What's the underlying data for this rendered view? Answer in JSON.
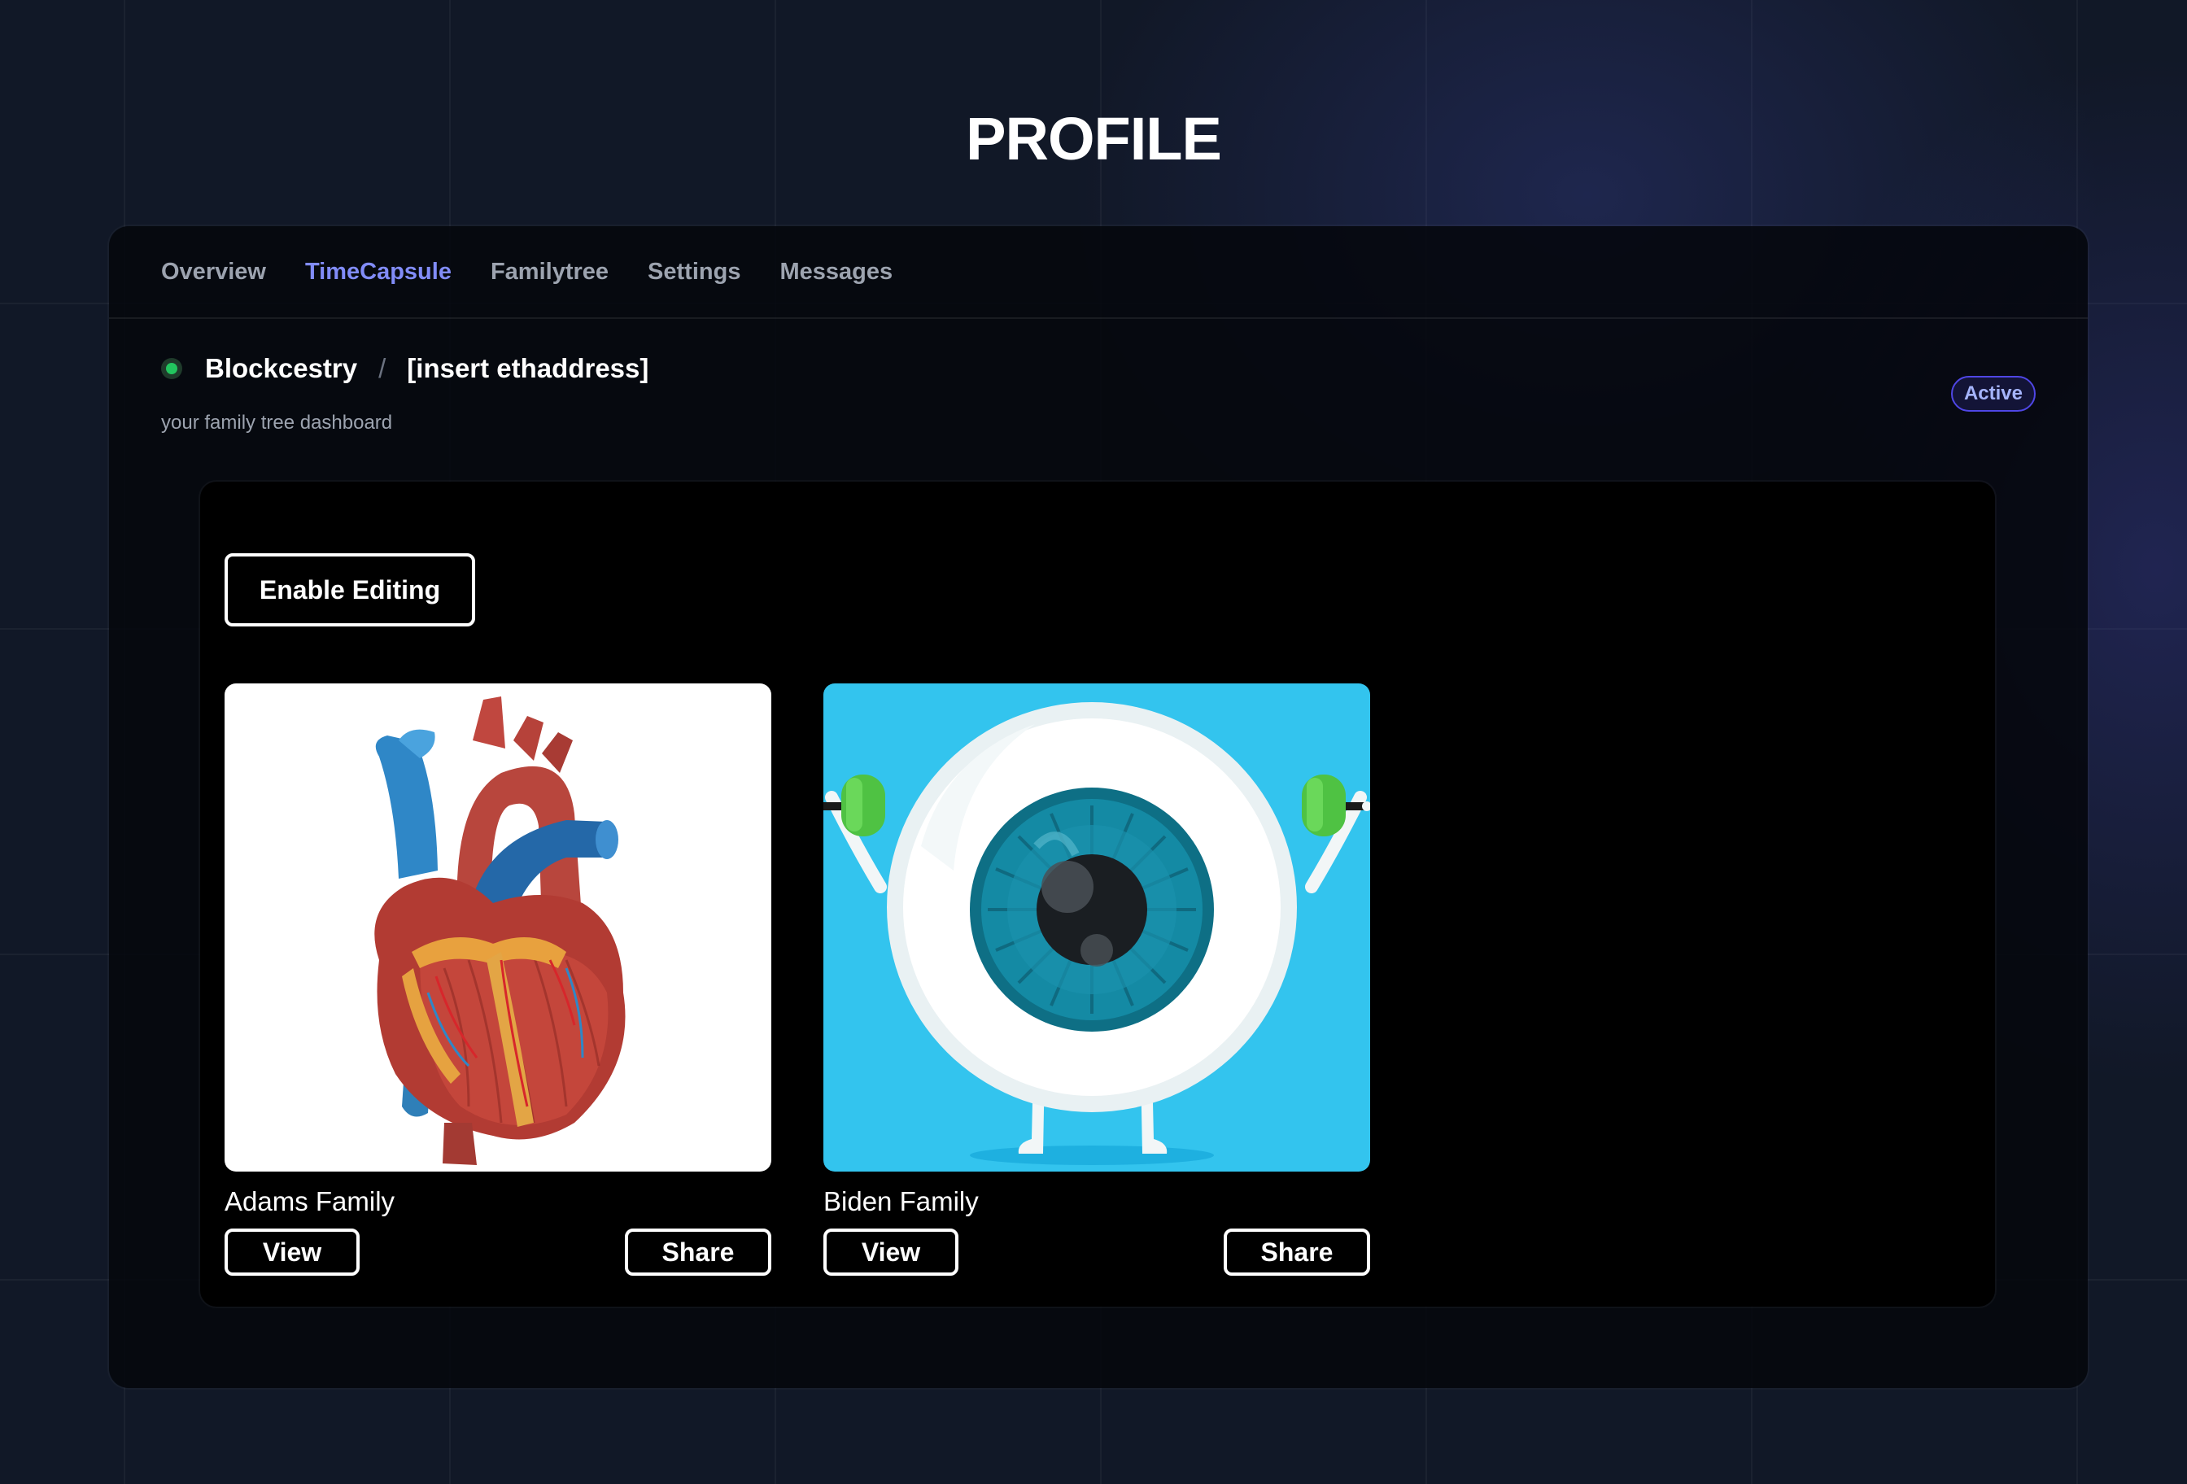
{
  "page": {
    "title": "PROFILE"
  },
  "tabs": [
    {
      "label": "Overview",
      "active": false
    },
    {
      "label": "TimeCapsule",
      "active": true
    },
    {
      "label": "Familytree",
      "active": false
    },
    {
      "label": "Settings",
      "active": false
    },
    {
      "label": "Messages",
      "active": false
    }
  ],
  "header": {
    "status": "online",
    "app_name": "Blockcestry",
    "separator": "/",
    "address": "[insert ethaddress]",
    "subtitle": "your family tree dashboard",
    "badge": "Active"
  },
  "editor": {
    "enable_label": "Enable Editing"
  },
  "cards": [
    {
      "title": "Adams Family",
      "image": "anatomical-heart-illustration",
      "view_label": "View",
      "share_label": "Share"
    },
    {
      "title": "Biden Family",
      "image": "cartoon-eyeball-illustration",
      "view_label": "View",
      "share_label": "Share"
    }
  ],
  "colors": {
    "accent": "#818cf8",
    "status_green": "#22c55e",
    "eye_background": "#33c4ee"
  }
}
